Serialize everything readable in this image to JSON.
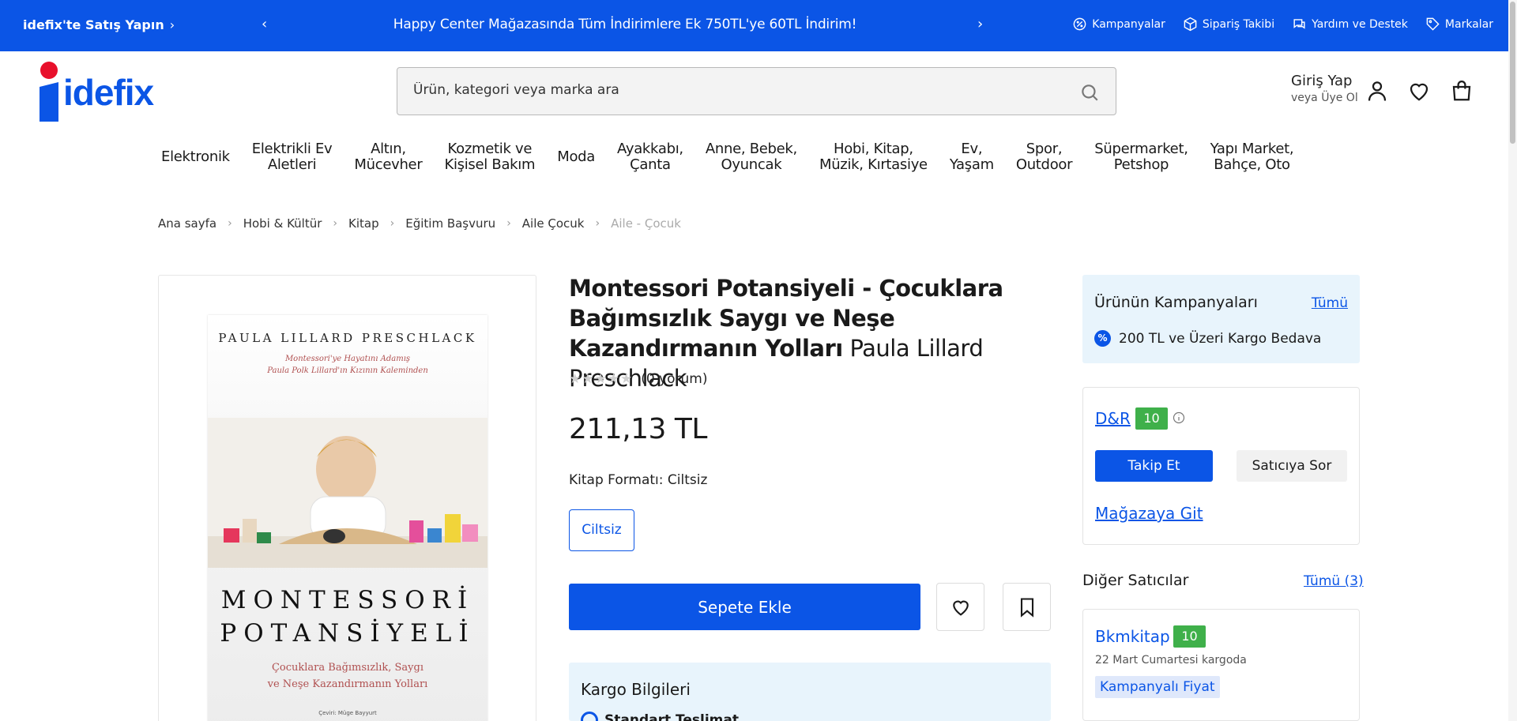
{
  "topbar": {
    "sell_label": "idefix'te Satış Yapın",
    "promo_text": "Happy Center Mağazasında Tüm İndirimlere Ek 750TL'ye 60TL İndirim!",
    "links": [
      {
        "label": "Kampanyalar",
        "icon": "percent-badge-icon"
      },
      {
        "label": "Sipariş Takibi",
        "icon": "package-icon"
      },
      {
        "label": "Yardım ve Destek",
        "icon": "chat-icon"
      },
      {
        "label": "Markalar",
        "icon": "tag-icon"
      }
    ]
  },
  "header": {
    "logo_text": "idefix",
    "search_placeholder": "Ürün, kategori veya marka ara",
    "login_title": "Giriş Yap",
    "login_sub": "veya Üye Ol"
  },
  "categories": [
    [
      "Elektronik"
    ],
    [
      "Elektrikli Ev",
      "Aletleri"
    ],
    [
      "Altın,",
      "Mücevher"
    ],
    [
      "Kozmetik ve",
      "Kişisel Bakım"
    ],
    [
      "Moda"
    ],
    [
      "Ayakkabı,",
      "Çanta"
    ],
    [
      "Anne, Bebek,",
      "Oyuncak"
    ],
    [
      "Hobi, Kitap,",
      "Müzik, Kırtasiye"
    ],
    [
      "Ev,",
      "Yaşam"
    ],
    [
      "Spor,",
      "Outdoor"
    ],
    [
      "Süpermarket,",
      "Petshop"
    ],
    [
      "Yapı Market,",
      "Bahçe, Oto"
    ]
  ],
  "breadcrumb": [
    "Ana sayfa",
    "Hobi & Kültür",
    "Kitap",
    "Eğitim Başvuru",
    "Aile Çocuk",
    "Aile - Çocuk"
  ],
  "cover": {
    "author": "PAULA LILLARD PRESCHLACK",
    "sub_line1": "Montessori'ye Hayatını Adamış",
    "sub_line2": "Paula Polk Lillard'ın Kızının Kaleminden",
    "title_line1": "MONTESSORİ",
    "title_line2": "POTANSİYELİ",
    "subtitle_line1": "Çocuklara Bağımsızlık, Saygı",
    "subtitle_line2": "ve Neşe Kazandırmanın Yolları",
    "translator": "Çeviri: Müge Bayyurt"
  },
  "product": {
    "title": "Montessori Potansiyeli - Çocuklara Bağımsızlık Saygı ve Neşe Kazandırmanın Yolları",
    "author": "Paula Lillard Preschlack",
    "stars": "★★★★★",
    "rating": 0,
    "reviews": "(0 yorum)",
    "price": "211,13 TL",
    "format_label": "Kitap Formatı: Ciltsiz",
    "format_option": "Ciltsiz",
    "add_to_cart": "Sepete Ekle"
  },
  "shipping": {
    "title": "Kargo Bilgileri",
    "standard": "Standart Teslimat"
  },
  "campaigns": {
    "title": "Ürünün Kampanyaları",
    "all_label": "Tümü",
    "item": "200 TL ve Üzeri Kargo Bedava"
  },
  "seller": {
    "name": "D&R",
    "score": "10",
    "follow_label": "Takip Et",
    "ask_label": "Satıcıya Sor",
    "goto_label": "Mağazaya Git"
  },
  "other_sellers": {
    "title": "Diğer Satıcılar",
    "all_label": "Tümü (3)",
    "items": [
      {
        "name": "Bkmkitap",
        "score": "10",
        "delivery": "22 Mart Cumartesi kargoda",
        "tag": "Kampanyalı Fiyat"
      }
    ]
  },
  "colors": {
    "brand_blue": "#0b55e6",
    "brand_red": "#e8102b",
    "score_green": "#3fb04a",
    "info_bg": "#e8f4fc"
  }
}
